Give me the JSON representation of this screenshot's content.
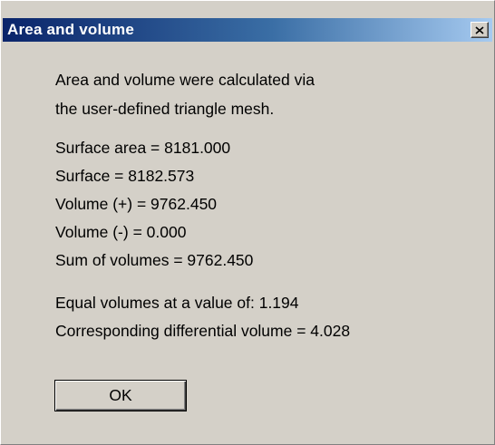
{
  "window": {
    "title": "Area and volume",
    "close_icon": "close-icon"
  },
  "message": {
    "intro_line1": "Area and volume were calculated via",
    "intro_line2": "the user-defined triangle mesh."
  },
  "results": {
    "surface_area": "Surface area = 8181.000",
    "surface": "Surface = 8182.573",
    "volume_plus": "Volume (+) = 9762.450",
    "volume_minus": "Volume (-) = 0.000",
    "sum_volumes": "Sum of volumes = 9762.450"
  },
  "equal": {
    "equal_volumes": "Equal volumes at a value of: 1.194",
    "differential": "Corresponding differential volume =  4.028"
  },
  "buttons": {
    "ok_label": "OK"
  },
  "colors": {
    "dialog_bg": "#d4d0c8",
    "title_start": "#0a246a",
    "title_end": "#a6caf0"
  }
}
